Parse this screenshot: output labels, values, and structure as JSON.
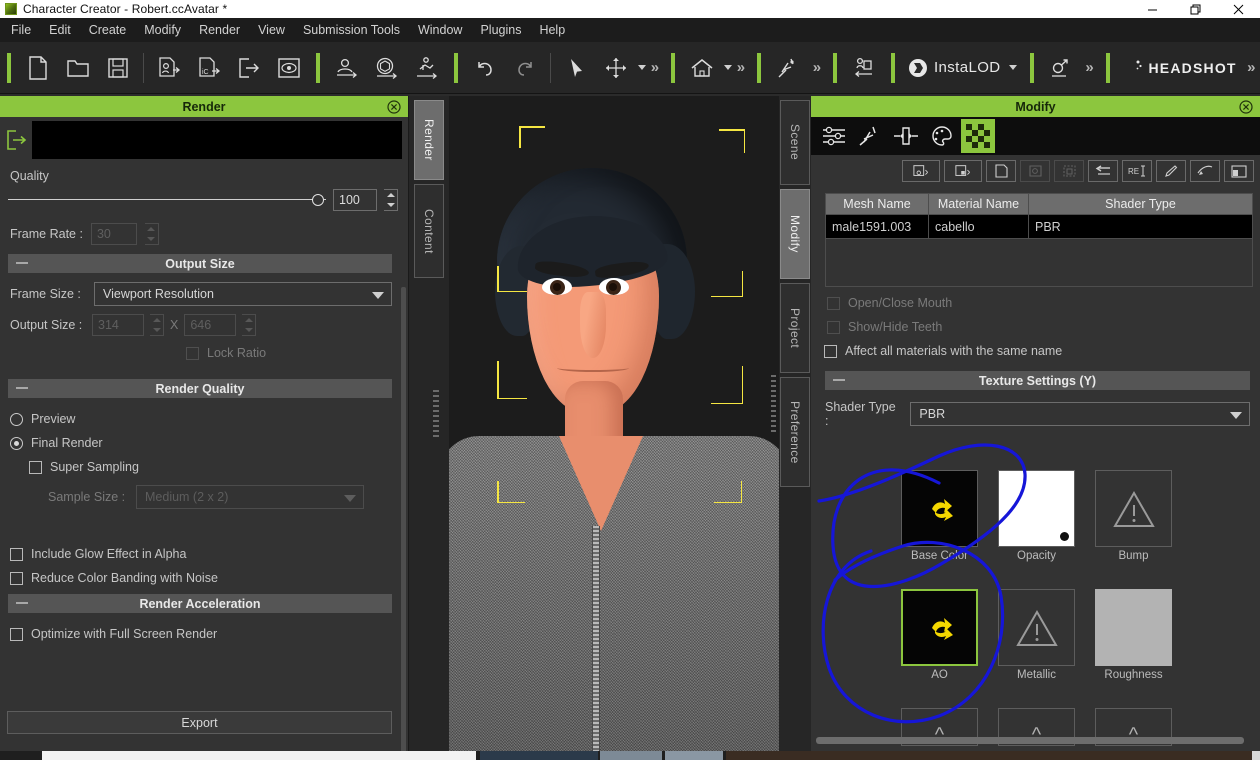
{
  "window": {
    "title": "Character Creator - Robert.ccAvatar *",
    "app_icon": "app-icon",
    "minimize": "–",
    "maximize": "❐",
    "close": "✕"
  },
  "menubar": {
    "items": [
      "File",
      "Edit",
      "Create",
      "Modify",
      "Render",
      "View",
      "Submission Tools",
      "Window",
      "Plugins",
      "Help"
    ]
  },
  "toolbar": {
    "groups": [
      {
        "icons": [
          "new-file-icon",
          "open-folder-icon",
          "save-icon"
        ]
      },
      {
        "icons": [
          "import-character-icon",
          "import-object-icon",
          "export-icon",
          "preview-icon"
        ]
      },
      {
        "icons": [
          "create-character-icon",
          "create-prop-icon",
          "create-motion-icon"
        ]
      },
      {
        "icons": [
          "undo-icon",
          "redo-icon"
        ]
      },
      {
        "icons": [
          "select-arrow-icon",
          "move-transform-icon"
        ],
        "overflow": "»"
      },
      {
        "icons": [
          "home-view-icon"
        ],
        "overflow": "»"
      },
      {
        "icons": [
          "pose-edit-icon"
        ],
        "overflow": "»"
      },
      {
        "icons": [
          "transfer-skin-icon"
        ]
      },
      {
        "icons": [
          "instalod-icon"
        ],
        "label": "InstaLOD",
        "overflow": ""
      },
      {
        "icons": [
          "accurig-icon"
        ],
        "overflow": "»"
      },
      {
        "icons": [
          "headshot-icon"
        ],
        "label": "HEADSHOT",
        "overflow": "»"
      }
    ]
  },
  "render_panel": {
    "title": "Render",
    "close_icon": "close-icon",
    "preview_icon": "render-output-icon",
    "quality_label": "Quality",
    "quality_value": "100",
    "frame_rate_label": "Frame Rate :",
    "frame_rate_value": "30",
    "output_size_section": "Output Size",
    "frame_size_label": "Frame Size :",
    "frame_size_value": "Viewport Resolution",
    "output_size_label": "Output Size :",
    "output_width": "314",
    "output_x": "X",
    "output_height": "646",
    "lock_ratio_label": "Lock Ratio",
    "render_quality_section": "Render Quality",
    "preview_radio_label": "Preview",
    "final_render_radio_label": "Final Render",
    "super_sampling_label": "Super Sampling",
    "sample_size_label": "Sample Size :",
    "sample_size_value": "Medium (2 x 2)",
    "include_glow_label": "Include Glow Effect in Alpha",
    "reduce_banding_label": "Reduce Color Banding with Noise",
    "render_acceleration_section": "Render Acceleration",
    "optimize_fullscreen_label": "Optimize with Full Screen Render",
    "export_button": "Export"
  },
  "left_tabs": [
    {
      "label": "Render",
      "active": true
    },
    {
      "label": "Content",
      "active": false
    }
  ],
  "right_tabs": [
    {
      "label": "Scene",
      "active": false
    },
    {
      "label": "Modify",
      "active": true
    },
    {
      "label": "Project",
      "active": false
    },
    {
      "label": "Preference",
      "active": false
    }
  ],
  "viewport": {
    "selection_brackets": 4,
    "bracket_color": "#f5e642",
    "background": "#1c1c1c"
  },
  "modify_panel": {
    "title": "Modify",
    "close_icon": "close-icon",
    "tabs": [
      {
        "name": "attribute-icon",
        "active": false
      },
      {
        "name": "motion-icon",
        "active": false
      },
      {
        "name": "morph-icon",
        "active": false
      },
      {
        "name": "material-palette-icon",
        "active": false
      },
      {
        "name": "texture-checker-icon",
        "active": true
      }
    ],
    "tool_icons": [
      {
        "name": "save-material-icon",
        "disabled": false,
        "dropdown": true
      },
      {
        "name": "load-material-icon",
        "disabled": false,
        "dropdown": true
      },
      {
        "name": "copy-material-icon",
        "disabled": false,
        "dropdown": false
      },
      {
        "name": "paste-material-icon",
        "disabled": true,
        "dropdown": false
      },
      {
        "name": "merge-material-icon",
        "disabled": true,
        "dropdown": false
      },
      {
        "name": "reset-material-icon",
        "disabled": false,
        "dropdown": false
      },
      {
        "name": "rename-material-icon",
        "disabled": false,
        "dropdown": false
      },
      {
        "name": "pick-material-icon",
        "disabled": false,
        "dropdown": false
      },
      {
        "name": "paint-material-icon",
        "disabled": false,
        "dropdown": false
      },
      {
        "name": "split-view-icon",
        "disabled": false,
        "dropdown": false
      }
    ],
    "mesh_table": {
      "headers": [
        "Mesh Name",
        "Material Name",
        "Shader Type"
      ],
      "rows": [
        [
          "male1591.003",
          "cabello",
          "PBR"
        ]
      ]
    },
    "open_close_mouth_label": "Open/Close Mouth",
    "show_hide_teeth_label": "Show/Hide Teeth",
    "affect_all_label": "Affect all materials with the same name",
    "texture_settings_section": "Texture Settings  (Y)",
    "shader_type_label": "Shader Type :",
    "shader_type_value": "PBR",
    "textures": [
      {
        "label": "Base Color",
        "state": "image-black-yellow",
        "selected": false
      },
      {
        "label": "Opacity",
        "state": "image-white",
        "selected": false
      },
      {
        "label": "Bump",
        "state": "empty-warning",
        "selected": false
      },
      {
        "label": "AO",
        "state": "image-black-yellow",
        "selected": true
      },
      {
        "label": "Metallic",
        "state": "empty-warning",
        "selected": false
      },
      {
        "label": "Roughness",
        "state": "image-grey",
        "selected": false
      }
    ]
  },
  "annotations": {
    "color": "#1616d8",
    "shapes": [
      "circle-around-base-color",
      "circle-around-ao"
    ]
  },
  "colors": {
    "accent_green": "#8cc63e",
    "panel_bg": "#333333",
    "toolbar_bg": "#262626",
    "viewport_bg": "#1c1c1c",
    "annotation_blue": "#1616d8"
  }
}
